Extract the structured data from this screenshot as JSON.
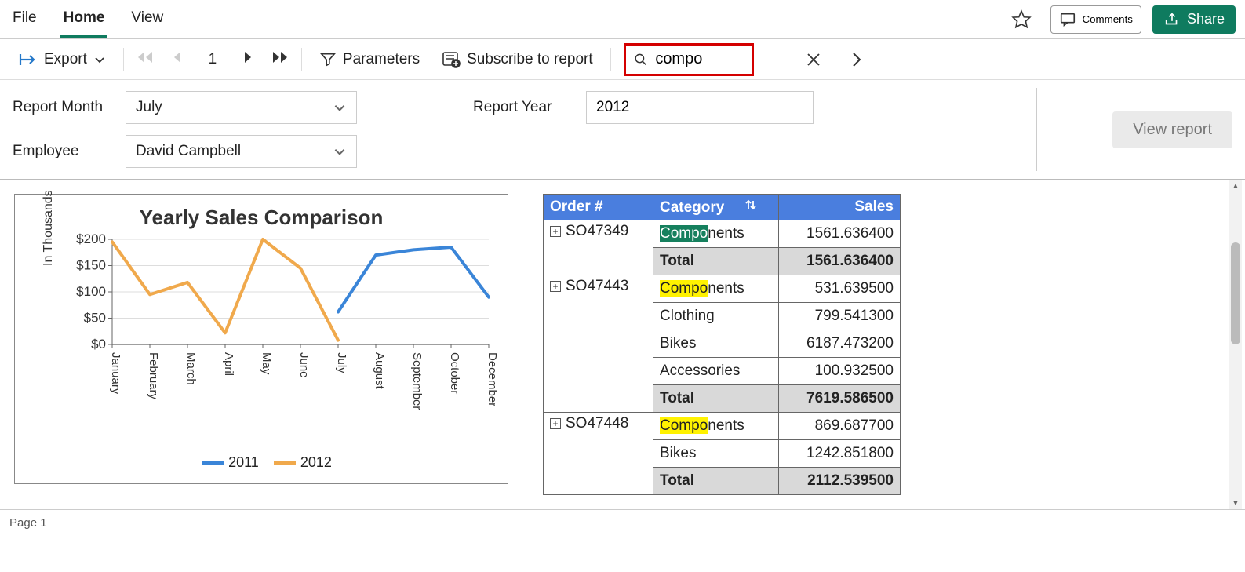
{
  "tabs": {
    "file": "File",
    "home": "Home",
    "view": "View"
  },
  "top_actions": {
    "comments": "Comments",
    "share": "Share"
  },
  "toolbar": {
    "export": "Export",
    "page": "1",
    "parameters": "Parameters",
    "subscribe": "Subscribe to report"
  },
  "search": {
    "value": "compo"
  },
  "params": {
    "month_label": "Report Month",
    "month_value": "July",
    "year_label": "Report Year",
    "year_value": "2012",
    "employee_label": "Employee",
    "employee_value": "David Campbell",
    "view_report": "View report"
  },
  "footer": {
    "page": "Page 1"
  },
  "chart": {
    "title": "Yearly Sales Comparison",
    "y_axis": "In Thousands"
  },
  "legend": {
    "s1": "2011",
    "s2": "2012"
  },
  "table": {
    "headers": {
      "order": "Order #",
      "category": "Category",
      "sales": "Sales"
    },
    "rows": [
      {
        "order": "SO47349",
        "category_pre": "Compo",
        "category_post": "nents",
        "hl": "green",
        "sales": "1561.636400",
        "total": false,
        "showOrder": true
      },
      {
        "order": "",
        "category": "Total",
        "sales": "1561.636400",
        "total": true
      },
      {
        "order": "SO47443",
        "category_pre": "Compo",
        "category_post": "nents",
        "hl": "yellow",
        "sales": "531.639500",
        "total": false,
        "showOrder": true
      },
      {
        "order": "",
        "category": "Clothing",
        "sales": "799.541300",
        "total": false
      },
      {
        "order": "",
        "category": "Bikes",
        "sales": "6187.473200",
        "total": false
      },
      {
        "order": "",
        "category": "Accessories",
        "sales": "100.932500",
        "total": false
      },
      {
        "order": "",
        "category": "Total",
        "sales": "7619.586500",
        "total": true
      },
      {
        "order": "SO47448",
        "category_pre": "Compo",
        "category_post": "nents",
        "hl": "yellow",
        "sales": "869.687700",
        "total": false,
        "showOrder": true
      },
      {
        "order": "",
        "category": "Bikes",
        "sales": "1242.851800",
        "total": false
      },
      {
        "order": "",
        "category": "Total",
        "sales": "2112.539500",
        "total": true
      }
    ]
  },
  "chart_data": {
    "type": "line",
    "title": "Yearly Sales Comparison",
    "ylabel": "In Thousands",
    "xlabel": "",
    "ylim": [
      0,
      200
    ],
    "categories": [
      "January",
      "February",
      "March",
      "April",
      "May",
      "June",
      "July",
      "August",
      "September",
      "October",
      "December"
    ],
    "series": [
      {
        "name": "2011",
        "values": [
          null,
          null,
          null,
          null,
          null,
          null,
          62,
          170,
          180,
          185,
          90
        ],
        "color": "#3a85d8"
      },
      {
        "name": "2012",
        "values": [
          195,
          95,
          118,
          22,
          200,
          145,
          8,
          null,
          null,
          null,
          null
        ],
        "color": "#f0a94c"
      }
    ]
  }
}
